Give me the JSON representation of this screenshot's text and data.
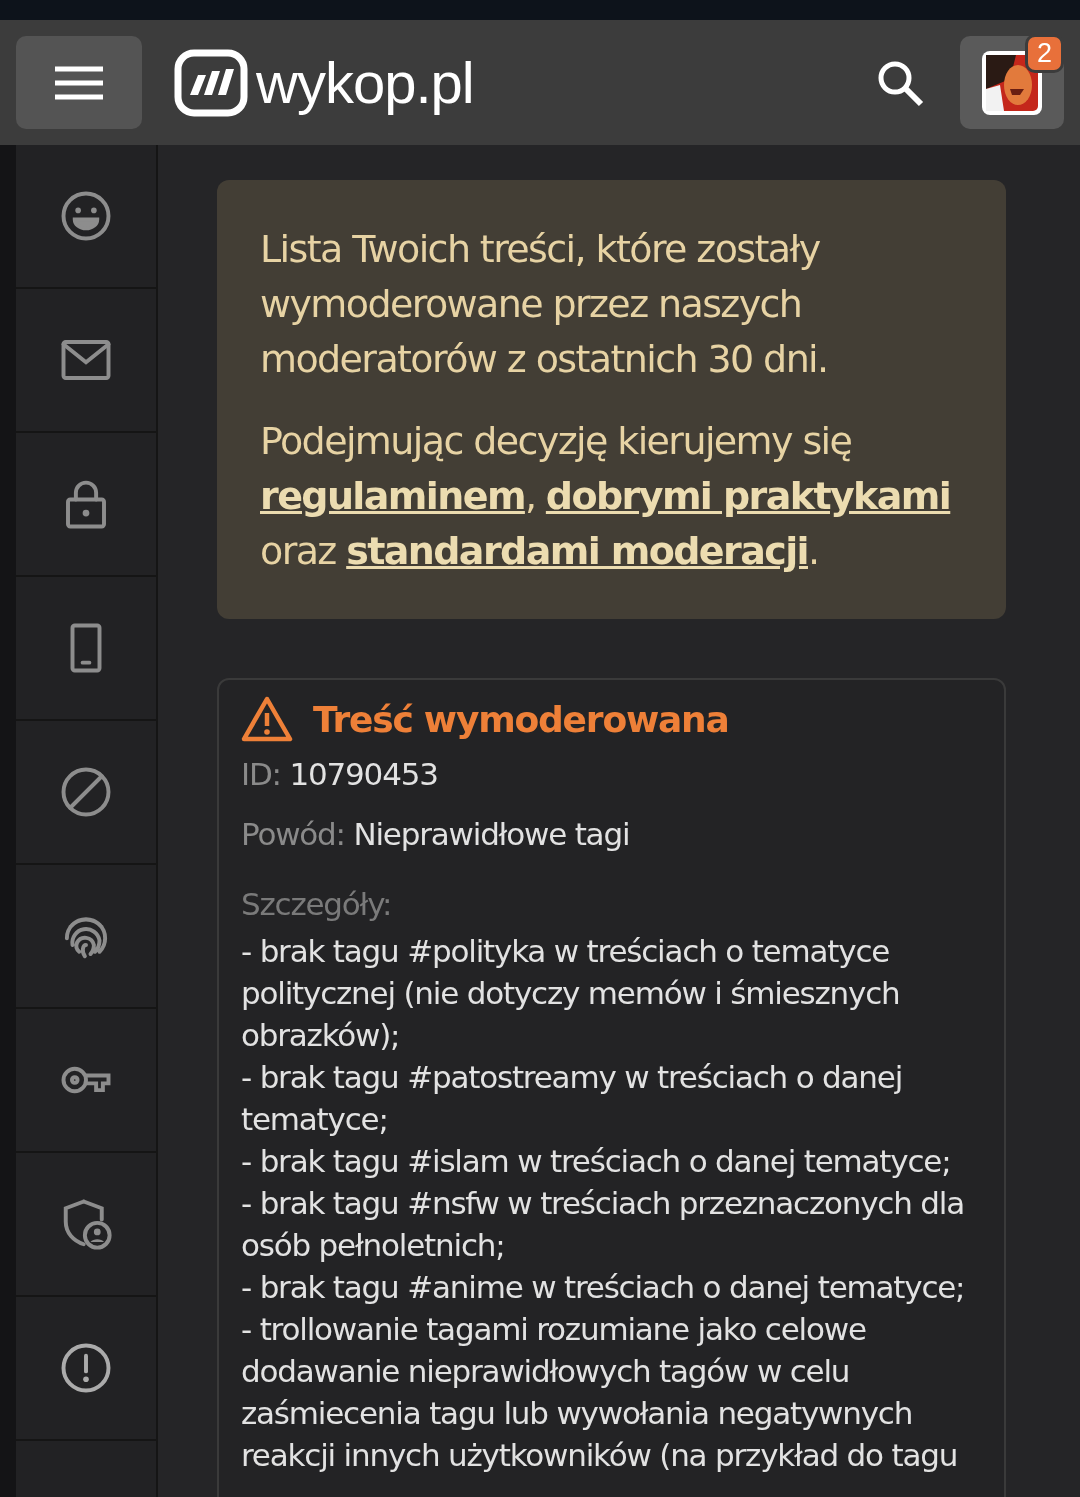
{
  "header": {
    "logo": "wykop.pl",
    "notifications": "2"
  },
  "sidebar": {
    "items": [
      {
        "kind": "smile"
      },
      {
        "kind": "mail"
      },
      {
        "kind": "lock"
      },
      {
        "kind": "phone"
      },
      {
        "kind": "ban"
      },
      {
        "kind": "fingerprint"
      },
      {
        "kind": "key"
      },
      {
        "kind": "shield-user"
      },
      {
        "kind": "alert"
      }
    ]
  },
  "info": {
    "intro": "Lista Twoich treści, które zostały wymoderowane przez naszych moderatorów z ostatnich 30 dni.",
    "rules": [
      {
        "kind": "text",
        "text": "Podejmując decyzję kierujemy się "
      },
      {
        "kind": "link",
        "text": "regulaminem"
      },
      {
        "kind": "text",
        "text": ", "
      },
      {
        "kind": "link",
        "text": "dobrymi praktykami"
      },
      {
        "kind": "text",
        "text": " oraz "
      },
      {
        "kind": "link",
        "text": "standardami moderacji"
      },
      {
        "kind": "text",
        "text": "."
      }
    ]
  },
  "card": {
    "title": "Treść wymoderowana",
    "fields": [
      {
        "label": "ID:",
        "value": "10790453"
      },
      {
        "label": "Powód:",
        "value": "Nieprawidłowe tagi"
      }
    ],
    "details_label": "Szczegóły:",
    "details": [
      "- brak tagu #polityka w treściach o tematyce politycznej (nie dotyczy memów i śmiesznych obrazków);",
      "- brak tagu #patostreamy w treściach o danej tematyce;",
      "- brak tagu #islam w treściach o danej tematyce;",
      "- brak tagu #nsfw w treściach przeznaczonych dla osób pełnoletnich;",
      "- brak tagu #anime w treściach o danej tematyce;",
      "- trollowanie tagami rozumiane jako celowe dodawanie nieprawidłowych tagów w celu zaśmiecenia tagu lub wywołania negatywnych reakcji innych użytkowników (na przykład do tagu"
    ]
  }
}
